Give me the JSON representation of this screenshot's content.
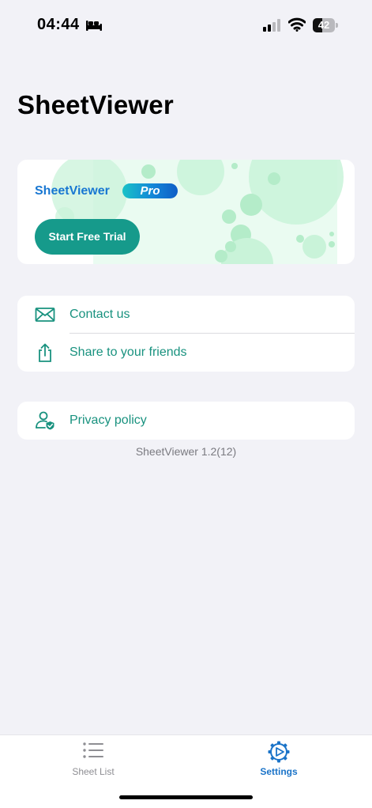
{
  "status_bar": {
    "time": "04:44",
    "battery": "42",
    "battery_level": 0.42,
    "icons": [
      "bed-icon",
      "cellular-signal-icon",
      "wifi-icon",
      "battery-icon"
    ]
  },
  "page": {
    "title": "SheetViewer"
  },
  "pro_card": {
    "brand": "SheetViewer",
    "badge": "Pro",
    "trial_button": "Start Free Trial",
    "colors": {
      "brand": "#1877d2",
      "button": "#169a8b",
      "bubbles": "#c9f3d9"
    }
  },
  "menu": {
    "group1": [
      {
        "label": "Contact us",
        "icon": "envelope-icon"
      },
      {
        "label": "Share to your friends",
        "icon": "share-icon"
      }
    ],
    "group2": [
      {
        "label": "Privacy policy",
        "icon": "person-shield-icon"
      }
    ]
  },
  "version": "SheetViewer 1.2(12)",
  "tab_bar": {
    "tabs": [
      {
        "label": "Sheet List",
        "icon": "list-icon",
        "selected": false
      },
      {
        "label": "Settings",
        "icon": "gear-play-icon",
        "selected": true
      }
    ],
    "colors": {
      "active": "#1a73c8",
      "inactive": "#8e8e93"
    }
  },
  "colors": {
    "accent": "#19927f",
    "background": "#f2f2f7"
  }
}
